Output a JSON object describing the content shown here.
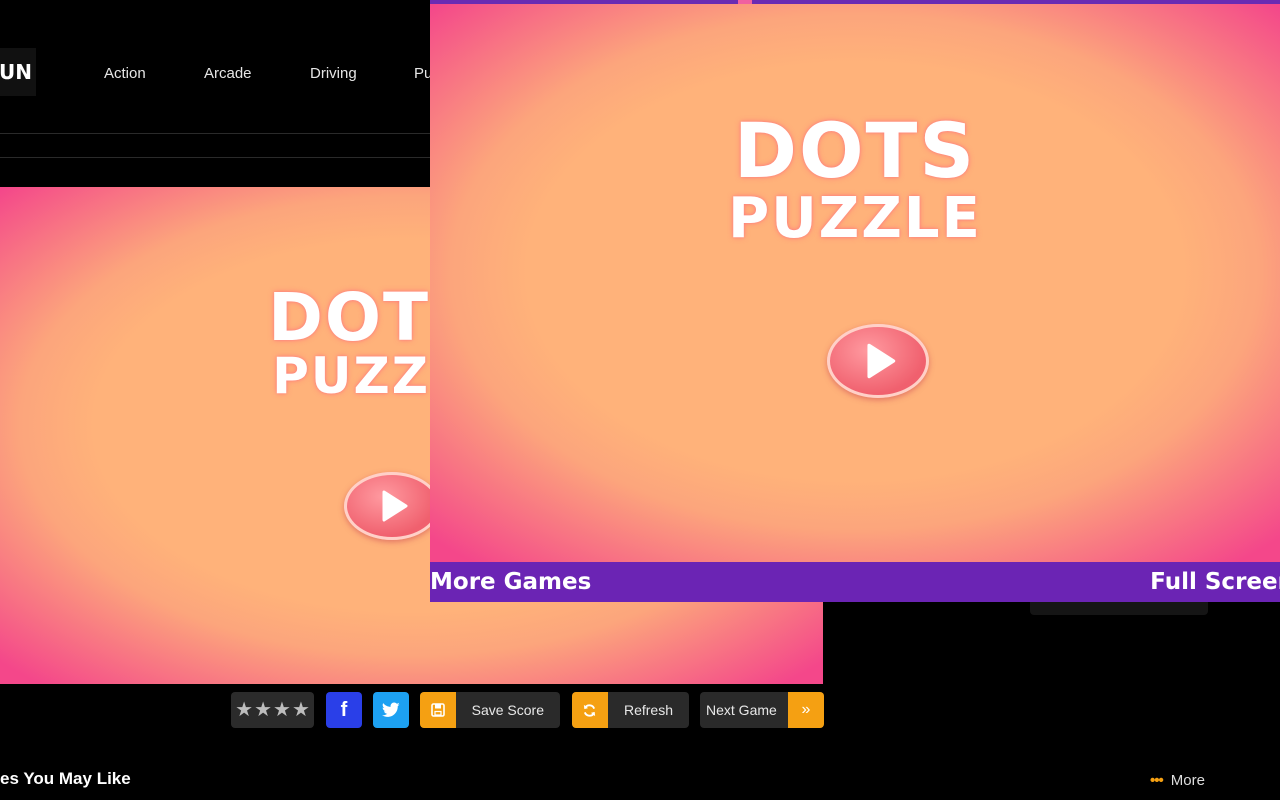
{
  "site": {
    "logo_text": "FUN",
    "nav": [
      "Action",
      "Arcade",
      "Driving",
      "Pu"
    ]
  },
  "game": {
    "title_line1": "DOTS",
    "title_line2": "PUZZLE",
    "bg_title_line1": "DOT",
    "bg_title_line2": "PUZZ",
    "more_games": "More Games",
    "full_screen": "Full Screen"
  },
  "toolbar": {
    "rating_stars": 4,
    "facebook_glyph": "f",
    "save_label": "Save Score",
    "refresh_label": "Refresh",
    "next_label": "Next Game",
    "next_glyph": "»"
  },
  "section": {
    "title": "es You May Like",
    "more_label": "More"
  },
  "colors": {
    "accent_orange": "#f5a012",
    "footer_purple": "#6b24b4",
    "facebook": "#2a3fe8",
    "twitter": "#1da1f2"
  },
  "icons": [
    "save-icon",
    "refresh-icon",
    "double-chevron-right-icon",
    "play-icon",
    "twitter-bird-icon",
    "facebook-icon",
    "star-icon"
  ]
}
